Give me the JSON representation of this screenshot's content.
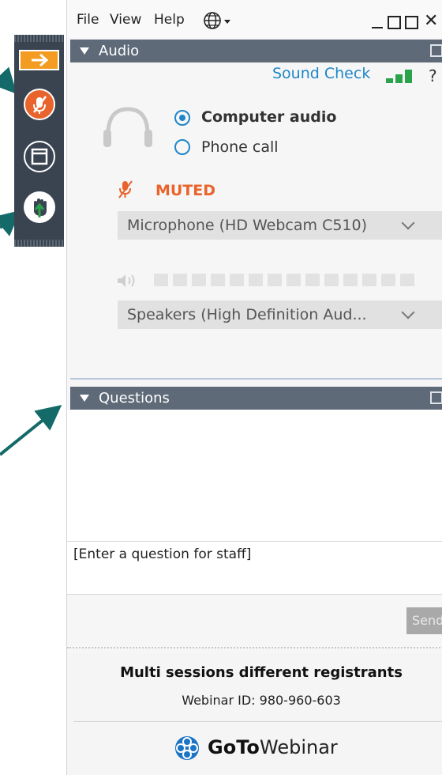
{
  "menu": {
    "file": "File",
    "view": "View",
    "help": "Help"
  },
  "audio": {
    "header": "Audio",
    "sound_check": "Sound Check",
    "options": [
      {
        "label": "Computer audio",
        "selected": true
      },
      {
        "label": "Phone call",
        "selected": false
      }
    ],
    "muted_label": "MUTED",
    "microphone": "Microphone (HD Webcam C510)",
    "speakers": "Speakers (High Definition Aud...",
    "speaker_level": 0
  },
  "questions": {
    "header": "Questions",
    "placeholder": "[Enter a question for staff]",
    "send_label": "Send"
  },
  "footer": {
    "session_title": "Multi sessions different registrants",
    "webinar_id": "Webinar ID: 980-960-603",
    "brand_bold": "GoTo",
    "brand_rest": "Webinar"
  },
  "colors": {
    "accent_orange": "#e8642c",
    "link_blue": "#1f86c8",
    "header_bg": "#5e6a78",
    "toolbar_bg": "#3a4451",
    "signal_green": "#2aa34a",
    "annotation_arrow": "#136a68"
  }
}
